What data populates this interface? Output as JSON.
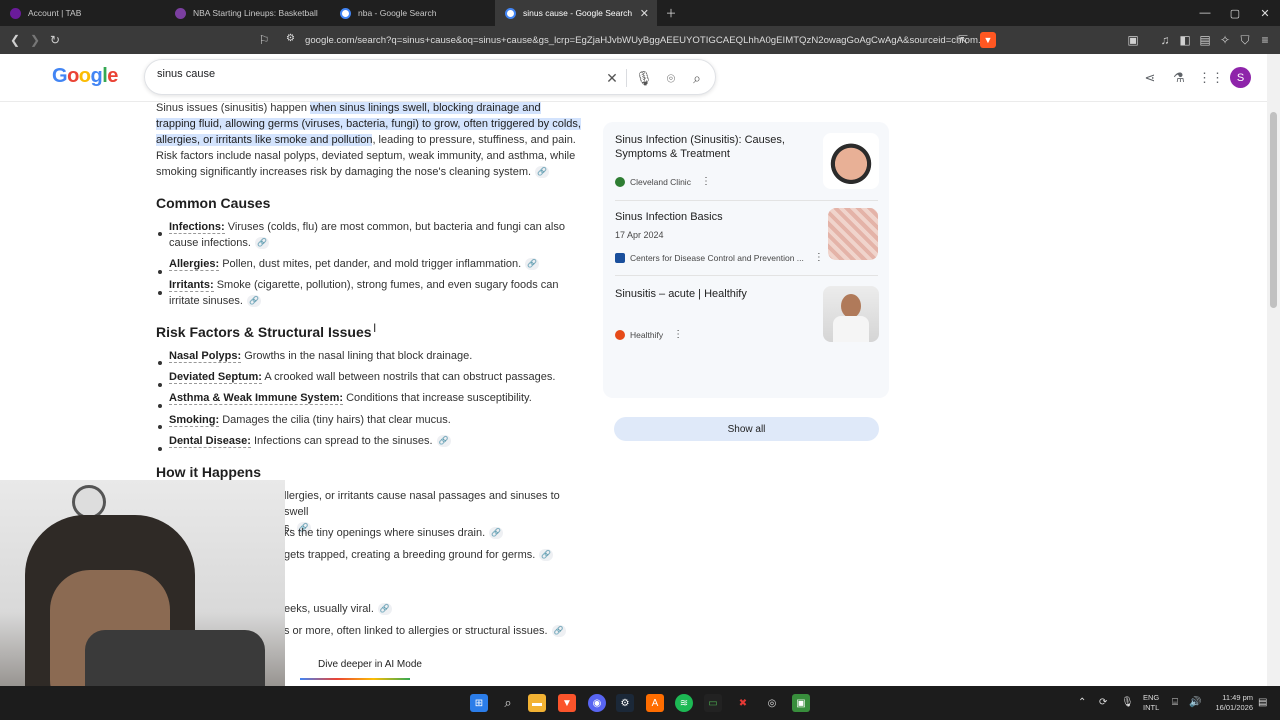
{
  "tabs": [
    {
      "title": "Account | TAB",
      "color": "#6a1b9a"
    },
    {
      "title": "NBA Starting Lineups: Basketball Dai",
      "color": "#7b3fa0"
    },
    {
      "title": "nba - Google Search",
      "color": "#4285f4"
    },
    {
      "title": "sinus cause - Google Search",
      "color": "#4285f4"
    }
  ],
  "address": {
    "url": "google.com/search?q=sinus+cause&oq=sinus+cause&gs_lcrp=EgZjaHJvbWUyBggAEEUYOTIGCAEQLhhA0gEIMTQzN2owagGoAgCwAgA&sourceid=chrom..."
  },
  "search": {
    "query": "sinus cause",
    "logo": "Google"
  },
  "header": {
    "avatar_letter": "S"
  },
  "intro": {
    "prefix": "Sinus issues (sinusitis) happen ",
    "highlight": "when sinus linings swell, blocking drainage and trapping fluid, allowing germs (viruses, bacteria, fungi) to grow, often triggered by colds, allergies, or irritants like smoke and pollution",
    "suffix": ", leading to pressure, stuffiness, and pain. Risk factors include nasal polyps, deviated septum, weak immunity, and asthma, while smoking significantly increases risk by damaging the nose's cleaning system."
  },
  "sections": {
    "common_causes": "Common Causes",
    "risk_factors": "Risk Factors & Structural Issues",
    "how_it_happens": "How it Happens"
  },
  "causes": [
    {
      "term": "Infections:",
      "text": "Viruses (colds, flu) are most common, but bacteria and fungi can also cause infections."
    },
    {
      "term": "Allergies:",
      "text": "Pollen, dust mites, pet dander, and mold trigger inflammation."
    },
    {
      "term": "Irritants:",
      "text": "Smoke (cigarette, pollution), strong fumes, and even sugary foods can irritate sinuses."
    }
  ],
  "risks": [
    {
      "term": "Nasal Polyps:",
      "text": "Growths in the nasal lining that block drainage."
    },
    {
      "term": "Deviated Septum:",
      "text": "A crooked wall between nostrils that can obstruct passages."
    },
    {
      "term": "Asthma & Weak Immune System:",
      "text": "Conditions that increase susceptibility."
    },
    {
      "term": "Smoking:",
      "text": "Damages the cilia (tiny hairs) that clear mucus."
    },
    {
      "term": "Dental Disease:",
      "text": "Infections can spread to the sinuses."
    }
  ],
  "how_partial": [
    {
      "line1": "llergies, or irritants cause nasal passages and sinuses to swell",
      "line2": "s."
    },
    {
      "line1": "ks the tiny openings where sinuses drain."
    },
    {
      "line1": "gets trapped, creating a breeding ground for germs."
    },
    {
      "line1": "eeks, usually viral."
    },
    {
      "line1": "s or more, often linked to allergies or structural issues."
    }
  ],
  "ai_mode": "Dive deeper in AI Mode",
  "sources": [
    {
      "title": "Sinus Infection (Sinusitis): Causes, Symptoms & Treatment",
      "date": "",
      "site": "Cleveland Clinic",
      "color": "#2e7d32"
    },
    {
      "title": "Sinus Infection Basics",
      "date": "17 Apr 2024",
      "site": "Centers for Disease Control and Prevention ...",
      "color": "#1a4f9c"
    },
    {
      "title": "Sinusitis – acute | Healthify",
      "date": "",
      "site": "Healthify",
      "color": "#e64a19"
    }
  ],
  "show_all": "Show all",
  "clock": {
    "time": "11:49 pm",
    "date": "16/01/2026",
    "lang1": "ENG",
    "lang2": "INTL"
  }
}
